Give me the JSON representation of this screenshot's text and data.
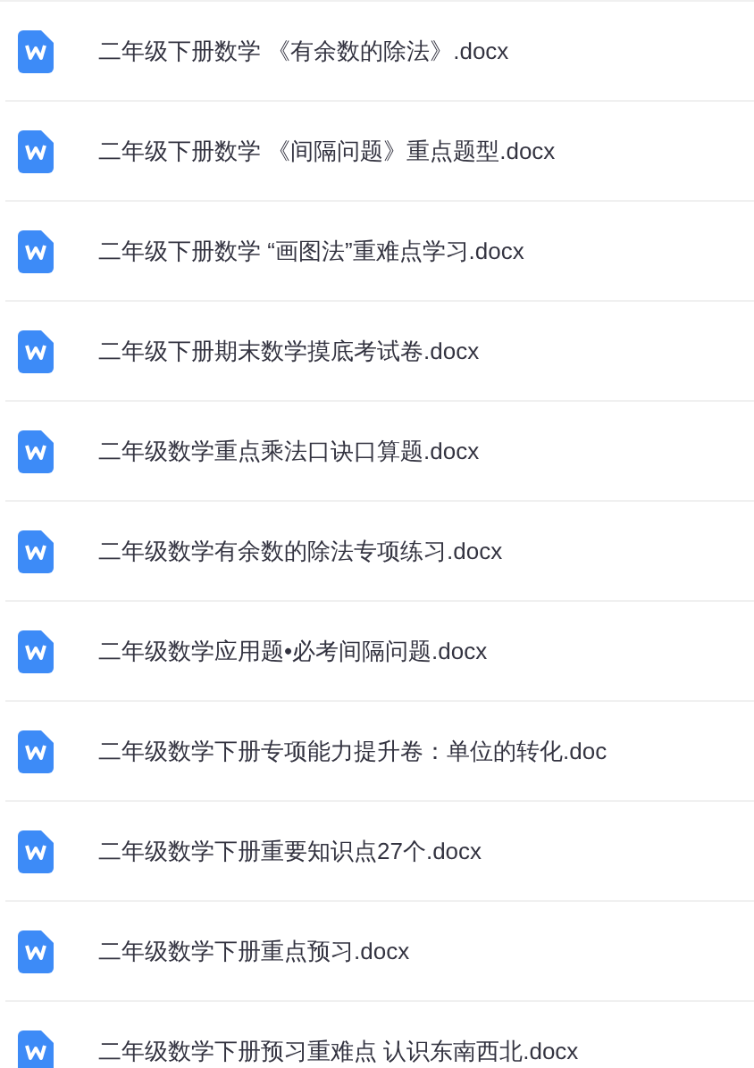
{
  "files": [
    {
      "name": "二年级下册数学 《有余数的除法》.docx"
    },
    {
      "name": "二年级下册数学 《间隔问题》重点题型.docx"
    },
    {
      "name": "二年级下册数学 “画图法”重难点学习.docx"
    },
    {
      "name": "二年级下册期末数学摸底考试卷.docx"
    },
    {
      "name": "二年级数学重点乘法口诀口算题.docx"
    },
    {
      "name": "二年级数学有余数的除法专项练习.docx"
    },
    {
      "name": "二年级数学应用题•必考间隔问题.docx"
    },
    {
      "name": "二年级数学下册专项能力提升卷：单位的转化.doc"
    },
    {
      "name": "二年级数学下册重要知识点27个.docx"
    },
    {
      "name": "二年级数学下册重点预习.docx"
    },
    {
      "name": "二年级数学下册预习重难点 认识东南西北.docx"
    }
  ]
}
